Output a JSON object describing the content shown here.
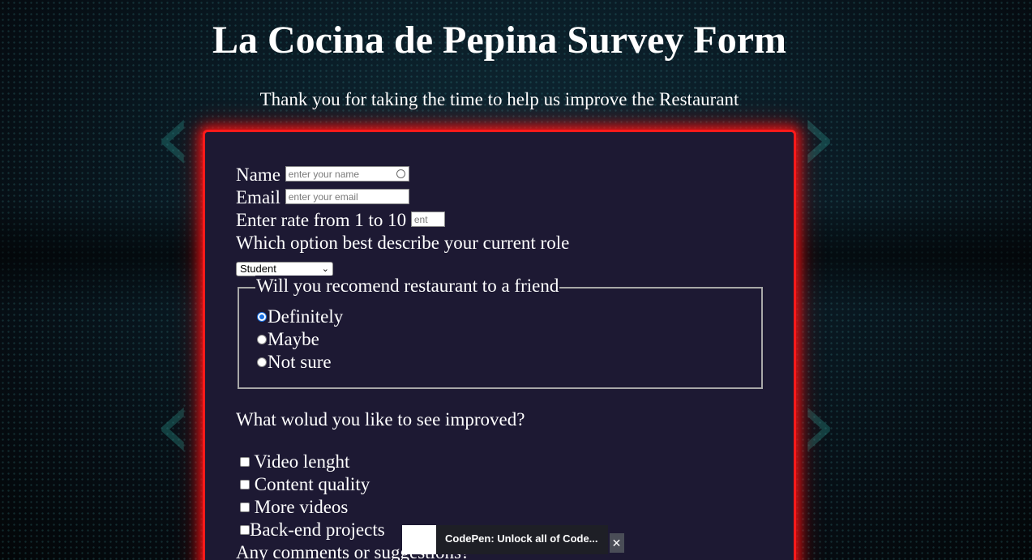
{
  "page": {
    "title": "La Cocina de Pepina Survey Form",
    "description": "Thank you for taking the time to help us improve the Restaurant"
  },
  "form": {
    "name": {
      "label": "Name",
      "placeholder": "enter your name"
    },
    "email": {
      "label": "Email",
      "placeholder": "enter your email"
    },
    "rate": {
      "label": "Enter rate from 1 to 10",
      "placeholder": "ent"
    },
    "role": {
      "label": "Which option best describe your current role",
      "selected": "Student"
    },
    "recommend": {
      "legend": "Will you recomend restaurant to a friend",
      "options": [
        {
          "label": "Definitely",
          "checked": true
        },
        {
          "label": "Maybe",
          "checked": false
        },
        {
          "label": "Not sure",
          "checked": false
        }
      ]
    },
    "improve": {
      "question": "What wolud you like to see improved?",
      "options": [
        {
          "label": "Video lenght",
          "checked": false
        },
        {
          "label": "Content quality",
          "checked": false
        },
        {
          "label": "More videos",
          "checked": false
        },
        {
          "label": "Back-end projects",
          "checked": false
        }
      ]
    },
    "comments": {
      "label": "Any comments or suggestions?"
    }
  },
  "toast": {
    "text": "CodePen: Unlock all of Code...",
    "close": "✕"
  },
  "colors": {
    "panel_bg": "#1d1933",
    "panel_border": "#ff1a1a",
    "page_bg": "#0a1c26",
    "radio_accent": "#1a6fe0"
  },
  "icons": {
    "contact": "contact-card-icon",
    "select": "chevron-down-icon",
    "close": "close-icon"
  }
}
